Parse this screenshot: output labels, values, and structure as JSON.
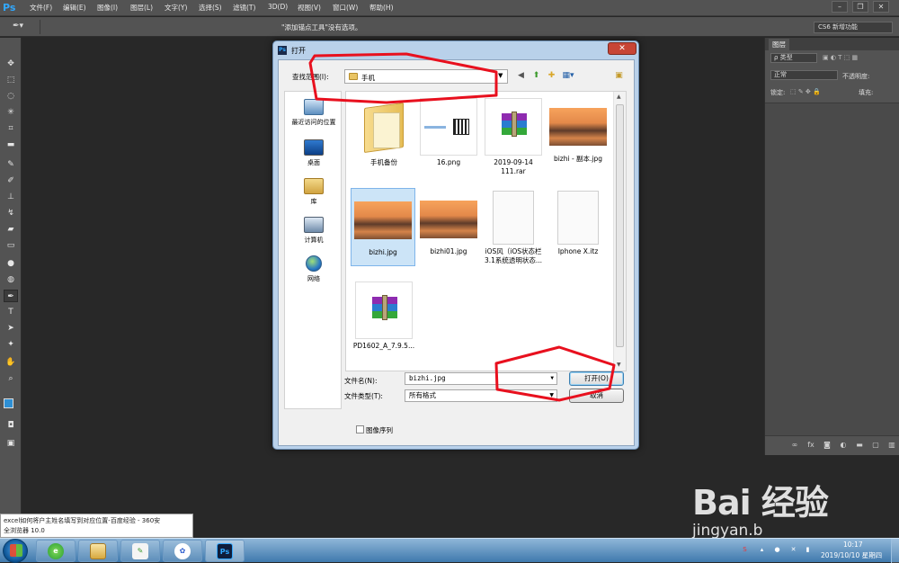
{
  "app": {
    "logo": "Ps",
    "menu": [
      "文件(F)",
      "编辑(E)",
      "图像(I)",
      "图层(L)",
      "文字(Y)",
      "选择(S)",
      "滤镜(T)",
      "3D(D)",
      "视图(V)",
      "窗口(W)",
      "帮助(H)"
    ],
    "tool_hint": "\"添加锚点工具\"没有选项。",
    "workspace": "CS6 新增功能"
  },
  "panel": {
    "tab": "图层",
    "kind_filter": "ρ 类型",
    "blend_mode": "正常",
    "opacity_label": "不透明度:",
    "lock_label": "锁定:",
    "fill_label": "填充:"
  },
  "dialog": {
    "title": "打开",
    "look_in_label": "查找范围(I):",
    "look_in_value": "手机",
    "places": [
      {
        "label": "最近访问的位置",
        "icon": "recent-places-icon"
      },
      {
        "label": "桌面",
        "icon": "desktop-icon"
      },
      {
        "label": "库",
        "icon": "libraries-icon"
      },
      {
        "label": "计算机",
        "icon": "computer-icon"
      },
      {
        "label": "网络",
        "icon": "network-icon"
      }
    ],
    "files": [
      {
        "name": "手机备份",
        "kind": "folder"
      },
      {
        "name": "16.png",
        "kind": "qr-image"
      },
      {
        "name": "2019-09-14\n111.rar",
        "kind": "rar"
      },
      {
        "name": "bizhi - 副本.jpg",
        "kind": "photo"
      },
      {
        "name": "bizhi.jpg",
        "kind": "photo",
        "selected": true
      },
      {
        "name": "bizhi01.jpg",
        "kind": "photo"
      },
      {
        "name": "iOS风（iOS状态栏\n3.1系统透明状态...",
        "kind": "document"
      },
      {
        "name": "Iphone X.itz",
        "kind": "document"
      },
      {
        "name": "PD1602_A_7.9.5...",
        "kind": "rar"
      }
    ],
    "filename_label": "文件名(N):",
    "filename_value": "bizhi.jpg",
    "filetype_label": "文件类型(T):",
    "filetype_value": "所有格式",
    "open_label": "打开(O)",
    "cancel_label": "取消",
    "sequence_label": "图像序列"
  },
  "tooltip": {
    "line1": "excel如何将户主姓名填写到对应位置-百度经验 - 360安",
    "line2": "全浏览器 10.0"
  },
  "watermark": {
    "brand": "Bai 经验",
    "url": "jingyan.b"
  },
  "taskbar": {
    "time": "10:17",
    "date": "2019/10/10 星期四"
  },
  "colors": {
    "annotation": "#e8101e",
    "ps_blue": "#31a8ff",
    "selection": "#cce4f7"
  }
}
